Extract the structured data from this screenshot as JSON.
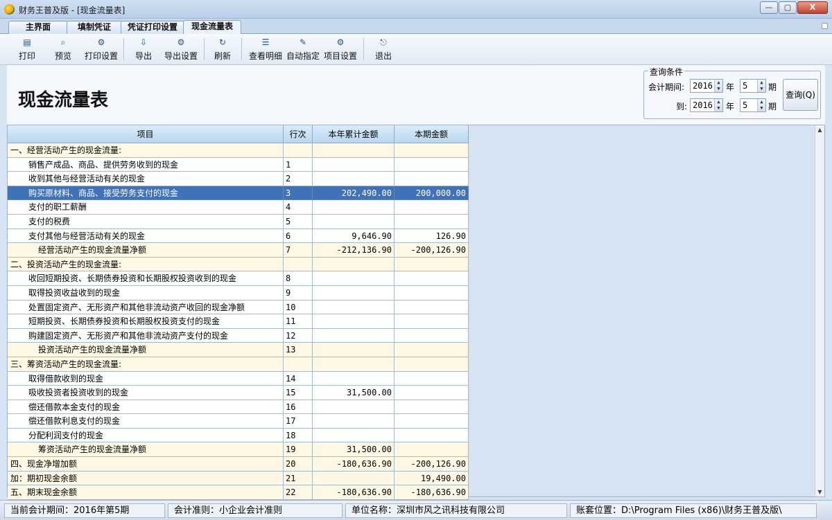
{
  "window": {
    "title": "财务王普及版 - [现金流量表]",
    "minimize": "—",
    "maximize": "▢",
    "close": "X"
  },
  "tabs": [
    {
      "label": "主界面"
    },
    {
      "label": "填制凭证"
    },
    {
      "label": "凭证打印设置"
    },
    {
      "label": "现金流量表",
      "active": true
    }
  ],
  "toolbar": {
    "print": "打印",
    "preview": "预览",
    "print_settings": "打印设置",
    "export": "导出",
    "export_settings": "导出设置",
    "refresh": "刷新",
    "view_detail": "查看明细",
    "auto_assign": "自动指定",
    "item_settings": "项目设置",
    "exit": "退出"
  },
  "report": {
    "title": "现金流量表"
  },
  "query": {
    "legend": "查询条件",
    "period_label": "会计期间:",
    "to_label": "到:",
    "from_year": "2016",
    "from_period": "5",
    "to_year": "2016",
    "to_period": "5",
    "year_unit": "年",
    "period_unit": "期",
    "button": "查询(Q)"
  },
  "table": {
    "columns": [
      "项目",
      "行次",
      "本年累计金额",
      "本期金额"
    ],
    "rows": [
      {
        "type": "section",
        "name": "一、经营活动产生的现金流量:",
        "line": "",
        "year": "",
        "period": ""
      },
      {
        "type": "item",
        "name": "销售产成品、商品、提供劳务收到的现金",
        "line": "1",
        "year": "",
        "period": ""
      },
      {
        "type": "item",
        "name": "收到其他与经营活动有关的现金",
        "line": "2",
        "year": "",
        "period": ""
      },
      {
        "type": "item selected",
        "name": "购买原材料、商品、接受劳务支付的现金",
        "line": "3",
        "year": "202,490.00",
        "period": "200,000.00"
      },
      {
        "type": "item",
        "name": "支付的职工薪酬",
        "line": "4",
        "year": "",
        "period": ""
      },
      {
        "type": "item",
        "name": "支付的税费",
        "line": "5",
        "year": "",
        "period": ""
      },
      {
        "type": "item",
        "name": "支付其他与经营活动有关的现金",
        "line": "6",
        "year": "9,646.90",
        "period": "126.90"
      },
      {
        "type": "subtotal",
        "name": "经营活动产生的现金流量净额",
        "line": "7",
        "year": "-212,136.90",
        "period": "-200,126.90"
      },
      {
        "type": "section",
        "name": "二、投资活动产生的现金流量:",
        "line": "",
        "year": "",
        "period": ""
      },
      {
        "type": "item",
        "name": "收回短期投资、长期债券投资和长期股权投资收到的现金",
        "line": "8",
        "year": "",
        "period": ""
      },
      {
        "type": "item",
        "name": "取得投资收益收到的现金",
        "line": "9",
        "year": "",
        "period": ""
      },
      {
        "type": "item",
        "name": "处置固定资产、无形资产和其他非流动资产收回的现金净额",
        "line": "10",
        "year": "",
        "period": ""
      },
      {
        "type": "item",
        "name": "短期投资、长期债券投资和长期股权投资支付的现金",
        "line": "11",
        "year": "",
        "period": ""
      },
      {
        "type": "item",
        "name": "购建固定资产、无形资产和其他非流动资产支付的现金",
        "line": "12",
        "year": "",
        "period": ""
      },
      {
        "type": "subtotal",
        "name": "投资活动产生的现金流量净额",
        "line": "13",
        "year": "",
        "period": ""
      },
      {
        "type": "section",
        "name": "三、筹资活动产生的现金流量:",
        "line": "",
        "year": "",
        "period": ""
      },
      {
        "type": "item",
        "name": "取得借款收到的现金",
        "line": "14",
        "year": "",
        "period": ""
      },
      {
        "type": "item",
        "name": "吸收投资者投资收到的现金",
        "line": "15",
        "year": "31,500.00",
        "period": ""
      },
      {
        "type": "item",
        "name": "偿还借款本金支付的现金",
        "line": "16",
        "year": "",
        "period": ""
      },
      {
        "type": "item",
        "name": "偿还借款利息支付的现金",
        "line": "17",
        "year": "",
        "period": ""
      },
      {
        "type": "item",
        "name": "分配利润支付的现金",
        "line": "18",
        "year": "",
        "period": ""
      },
      {
        "type": "subtotal",
        "name": "筹资活动产生的现金流量净额",
        "line": "19",
        "year": "31,500.00",
        "period": ""
      },
      {
        "type": "total",
        "name": "四、现金净增加额",
        "line": "20",
        "year": "-180,636.90",
        "period": "-200,126.90"
      },
      {
        "type": "total",
        "name": "加：期初现金余额",
        "line": "21",
        "year": "",
        "period": "19,490.00"
      },
      {
        "type": "total",
        "name": "五、期末现金余额",
        "line": "22",
        "year": "-180,636.90",
        "period": "-180,636.90"
      }
    ]
  },
  "statusbar": {
    "period": "当前会计期间：2016年第5期",
    "standard": "会计准则：小企业会计准则",
    "company": "单位名称：深圳市风之讯科技有限公司",
    "location": "账套位置：D:\\Program Files (x86)\\财务王普及版\\"
  }
}
